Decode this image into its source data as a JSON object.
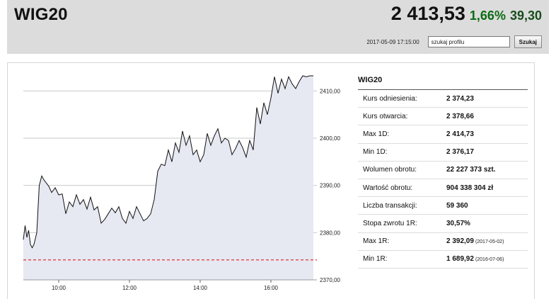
{
  "header": {
    "ticker": "WIG20",
    "price": "2 413,53",
    "change_pct": "1,66%",
    "change_abs": "39,30",
    "timestamp": "2017-05-09 17:15:00",
    "search_placeholder": "szukaj profilu",
    "search_button": "Szukaj"
  },
  "stats": {
    "title": "WIG20",
    "rows": [
      {
        "label": "Kurs odniesienia:",
        "value": "2 374,23",
        "date": ""
      },
      {
        "label": "Kurs otwarcia:",
        "value": "2 378,66",
        "date": ""
      },
      {
        "label": "Max 1D:",
        "value": "2 414,73",
        "date": ""
      },
      {
        "label": "Min 1D:",
        "value": "2 376,17",
        "date": ""
      },
      {
        "label": "Wolumen obrotu:",
        "value": "22 227 373 szt.",
        "date": ""
      },
      {
        "label": "Wartość obrotu:",
        "value": "904 338 304 zł",
        "date": ""
      },
      {
        "label": "Liczba transakcji:",
        "value": "59 360",
        "date": ""
      },
      {
        "label": "Stopa zwrotu 1R:",
        "value": "30,57%",
        "date": ""
      },
      {
        "label": "Max 1R:",
        "value": "2 392,09",
        "date": "(2017-05-02)"
      },
      {
        "label": "Min 1R:",
        "value": "1 689,92",
        "date": "(2016-07-06)"
      }
    ]
  },
  "colors": {
    "header_bg": "#dcdcdc",
    "change_positive": "#0b6b12",
    "line": "#111111",
    "area_fill": "#e6e8f2",
    "reference_line": "#d9221c"
  },
  "chart_data": {
    "type": "area",
    "reference_value": 2374.23,
    "ylim": [
      2370,
      2415
    ],
    "xlim": [
      9.0,
      17.3
    ],
    "y_ticks": [
      2370,
      2380,
      2390,
      2400,
      2410
    ],
    "y_tick_labels": [
      "2370,00",
      "2380,00",
      "2390,00",
      "2400,00",
      "2410,00"
    ],
    "x_ticks": [
      10,
      12,
      14,
      16
    ],
    "x_tick_labels": [
      "10:00",
      "12:00",
      "14:00",
      "16:00"
    ],
    "grid": true,
    "series": [
      {
        "x": [
          9.0,
          9.05,
          9.1,
          9.15,
          9.2,
          9.25,
          9.3,
          9.38,
          9.45,
          9.52,
          9.58,
          9.65,
          9.72,
          9.8,
          9.9,
          10.0,
          10.1,
          10.2,
          10.3,
          10.4,
          10.5,
          10.6,
          10.7,
          10.8,
          10.9,
          11.0,
          11.1,
          11.2,
          11.3,
          11.4,
          11.5,
          11.6,
          11.7,
          11.8,
          11.9,
          12.0,
          12.1,
          12.2,
          12.3,
          12.4,
          12.5,
          12.6,
          12.7,
          12.8,
          12.9,
          13.0,
          13.1,
          13.2,
          13.3,
          13.4,
          13.5,
          13.6,
          13.7,
          13.8,
          13.9,
          14.0,
          14.1,
          14.2,
          14.3,
          14.4,
          14.5,
          14.6,
          14.7,
          14.8,
          14.9,
          15.0,
          15.1,
          15.2,
          15.3,
          15.4,
          15.5,
          15.6,
          15.7,
          15.8,
          15.9,
          16.0,
          16.1,
          16.2,
          16.3,
          16.4,
          16.5,
          16.6,
          16.7,
          16.8,
          16.9,
          17.0,
          17.1,
          17.2
        ],
        "values": [
          2378.5,
          2381.5,
          2379.0,
          2380.5,
          2377.5,
          2376.8,
          2377.5,
          2380.0,
          2390.0,
          2392.0,
          2391.2,
          2390.5,
          2389.8,
          2388.5,
          2389.5,
          2388.0,
          2388.2,
          2384.0,
          2386.5,
          2385.5,
          2388.0,
          2386.0,
          2387.0,
          2385.0,
          2387.5,
          2384.8,
          2385.5,
          2382.0,
          2382.8,
          2384.0,
          2385.2,
          2384.2,
          2385.5,
          2383.0,
          2382.0,
          2384.5,
          2383.0,
          2385.5,
          2384.0,
          2382.5,
          2383.0,
          2384.0,
          2387.0,
          2393.0,
          2394.5,
          2394.2,
          2397.5,
          2395.0,
          2399.0,
          2397.0,
          2401.5,
          2398.5,
          2400.5,
          2396.5,
          2397.5,
          2395.0,
          2396.5,
          2401.0,
          2398.5,
          2400.5,
          2402.0,
          2399.0,
          2400.0,
          2399.5,
          2396.5,
          2397.8,
          2399.5,
          2398.0,
          2396.0,
          2399.5,
          2397.5,
          2406.5,
          2403.0,
          2407.5,
          2405.0,
          2408.5,
          2413.0,
          2409.5,
          2412.5,
          2410.5,
          2413.0,
          2411.5,
          2410.5,
          2412.0,
          2413.2,
          2413.0,
          2413.2,
          2413.2
        ]
      }
    ]
  }
}
